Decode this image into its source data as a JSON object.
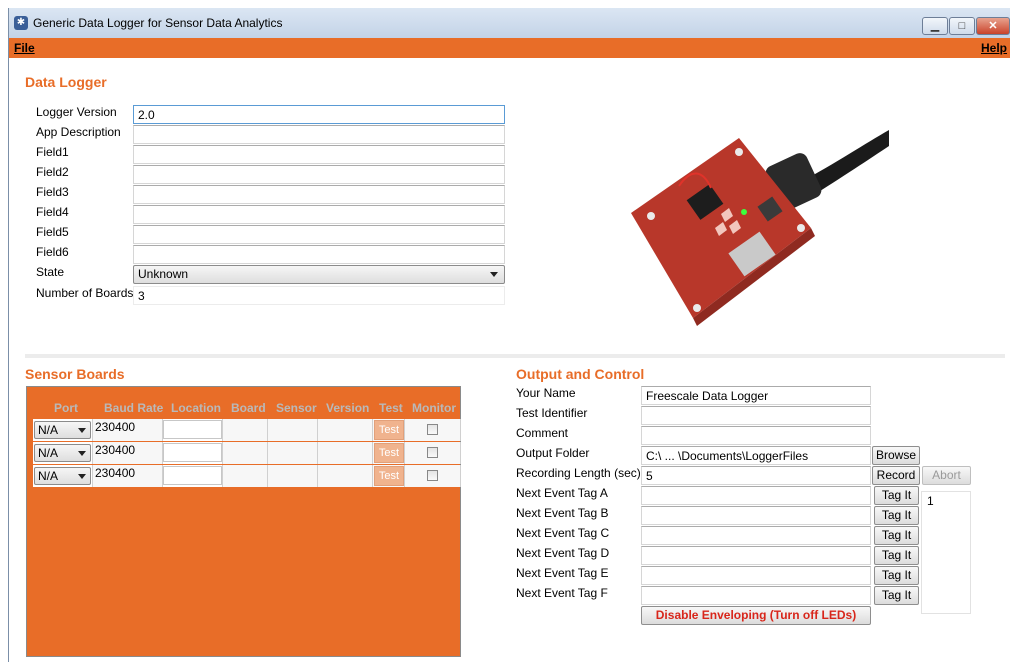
{
  "window": {
    "title": "Generic Data Logger for Sensor Data Analytics",
    "menu": {
      "file": "File",
      "help": "Help"
    }
  },
  "logger": {
    "title": "Data Logger",
    "fields": [
      {
        "label": "Logger Version",
        "value": "2.0"
      },
      {
        "label": "App Description",
        "value": ""
      },
      {
        "label": "Field1",
        "value": ""
      },
      {
        "label": "Field2",
        "value": ""
      },
      {
        "label": "Field3",
        "value": ""
      },
      {
        "label": "Field4",
        "value": ""
      },
      {
        "label": "Field5",
        "value": ""
      },
      {
        "label": "Field6",
        "value": ""
      }
    ],
    "state": {
      "label": "State",
      "value": "Unknown"
    },
    "boards": {
      "label": "Number of Boards",
      "value": "3"
    }
  },
  "sensor_boards": {
    "title": "Sensor Boards",
    "columns": [
      "Port",
      "Baud Rate",
      "Location",
      "Board",
      "Sensor",
      "Version",
      "Test",
      "Monitor"
    ],
    "rows": [
      {
        "port": "N/A",
        "baud": "230400",
        "test": "Test"
      },
      {
        "port": "N/A",
        "baud": "230400",
        "test": "Test"
      },
      {
        "port": "N/A",
        "baud": "230400",
        "test": "Test"
      }
    ]
  },
  "output": {
    "title": "Output and Control",
    "your_name": {
      "label": "Your Name",
      "value": "Freescale Data Logger"
    },
    "test_id": {
      "label": "Test Identifier",
      "value": ""
    },
    "comment": {
      "label": "Comment",
      "value": ""
    },
    "folder": {
      "label": "Output Folder",
      "value": "C:\\ ... \\Documents\\LoggerFiles",
      "button": "Browse"
    },
    "recording": {
      "label": "Recording Length (sec)",
      "value": "5",
      "record": "Record",
      "abort": "Abort"
    },
    "tags": [
      {
        "label": "Next Event Tag A",
        "button": "Tag It"
      },
      {
        "label": "Next Event Tag B",
        "button": "Tag It"
      },
      {
        "label": "Next Event Tag C",
        "button": "Tag It"
      },
      {
        "label": "Next Event Tag D",
        "button": "Tag It"
      },
      {
        "label": "Next Event Tag E",
        "button": "Tag It"
      },
      {
        "label": "Next Event Tag F",
        "button": "Tag It"
      }
    ],
    "tag_count": "1",
    "disable_button": "Disable Enveloping (Turn off LEDs)"
  },
  "colors": {
    "accent": "#e86d28",
    "disabled_test": "#f0b38e",
    "warning_text": "#d8261b"
  },
  "icons": {
    "app": "app-icon",
    "board": "sensor-board-image"
  }
}
